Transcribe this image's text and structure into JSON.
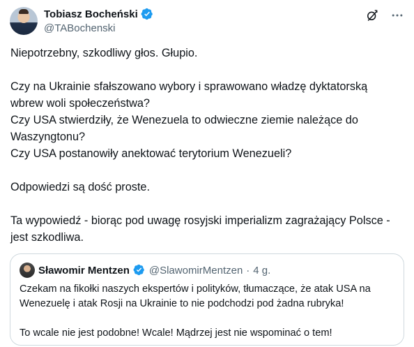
{
  "author": {
    "display_name": "Tobiasz Bocheński",
    "handle": "@TABochenski"
  },
  "icons": {
    "verified": "verified-badge-icon",
    "grok": "grok-icon",
    "more": "more-icon"
  },
  "colors": {
    "verified": "#1d9bf0",
    "text": "#0f1419",
    "secondary": "#536471",
    "border": "#cfd9de"
  },
  "post": {
    "paragraphs": [
      "Niepotrzebny, szkodliwy głos. Głupio.",
      "Czy na Ukrainie sfałszowano wybory i sprawowano władzę dyktatorską wbrew woli społeczeństwa?",
      "Czy USA stwierdziły, że Wenezuela to odwieczne ziemie należące do Waszyngtonu?",
      "Czy USA postanowiły anektować terytorium Wenezueli?",
      "Odpowiedzi są dość proste.",
      "Ta wypowiedź - biorąc pod uwagę rosyjski imperializm zagrażający Polsce - jest szkodliwa."
    ]
  },
  "quote": {
    "display_name": "Sławomir Mentzen",
    "handle": "@SlawomirMentzen",
    "separator": "·",
    "time": "4 g.",
    "paragraphs": [
      "Czekam na fikołki naszych ekspertów i polityków, tłumaczące, że atak USA na Wenezuelę i atak Rosji na Ukrainie to nie podchodzi pod żadna rubryka!",
      "To wcale nie jest podobne! Wcale! Mądrzej jest nie wspominać o tem!"
    ]
  }
}
